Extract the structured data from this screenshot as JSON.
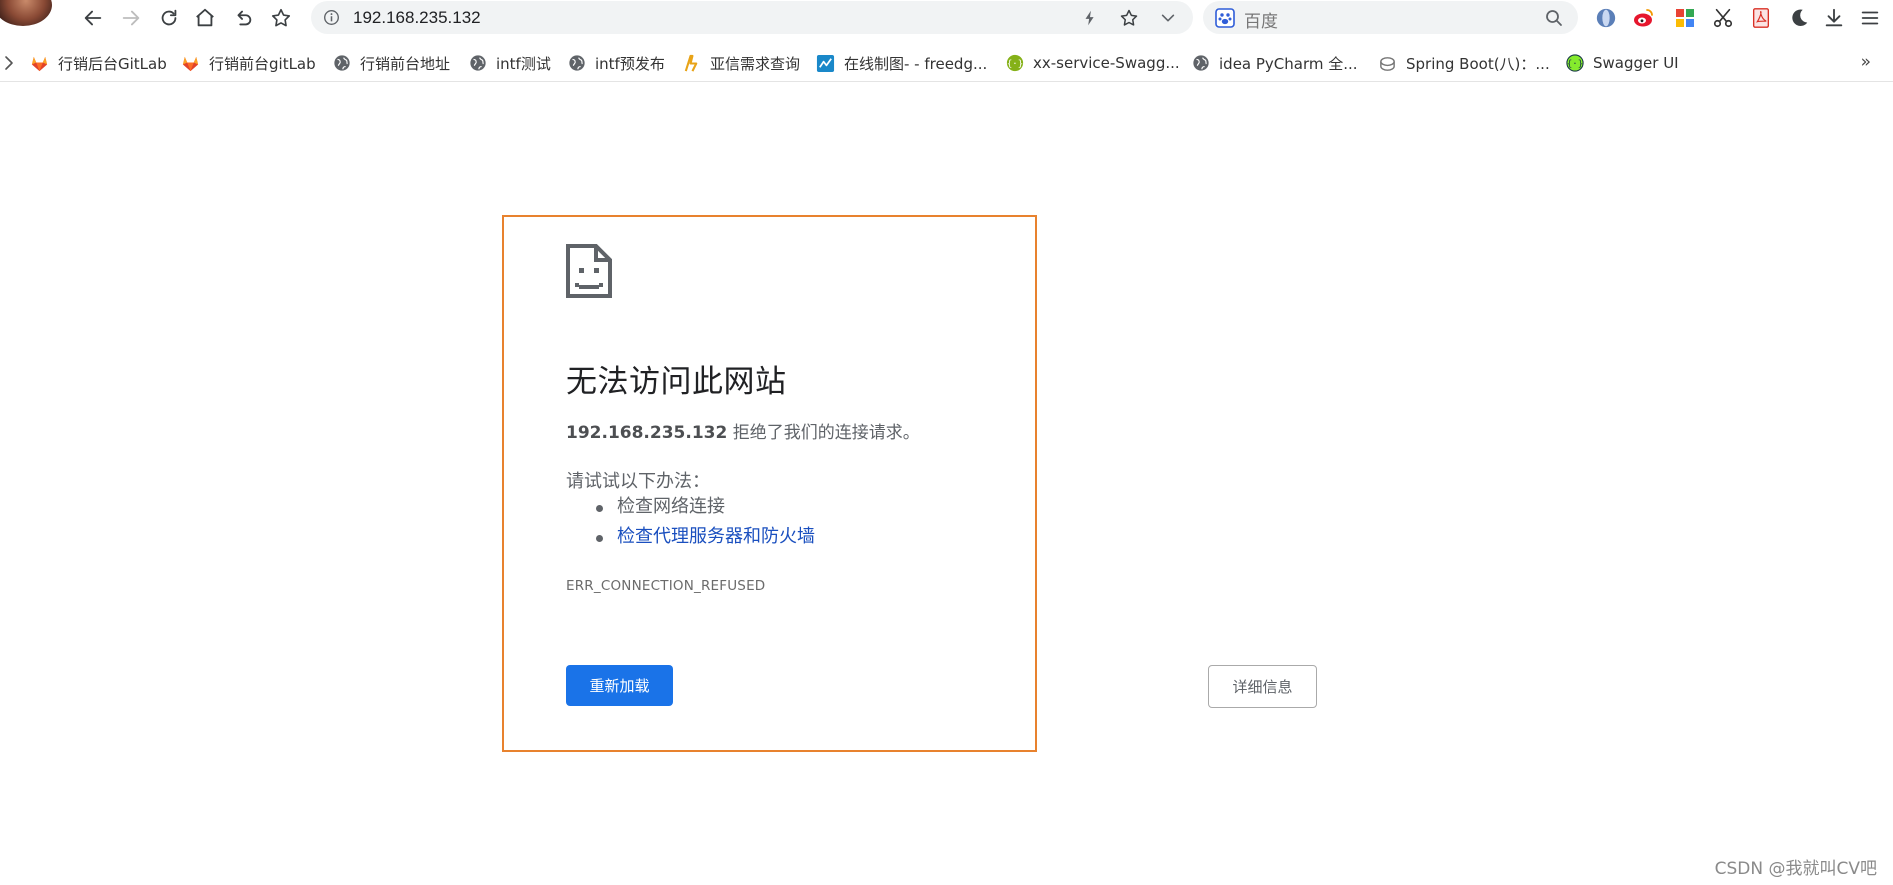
{
  "toolbar": {
    "url": "192.168.235.132",
    "search_placeholder": "百度"
  },
  "bookmarks": [
    {
      "label": "行销后台GitLab",
      "icon": "gitlab-icon"
    },
    {
      "label": "行销前台gitLab",
      "icon": "gitlab-icon"
    },
    {
      "label": "行销前台地址",
      "icon": "globe-icon"
    },
    {
      "label": "intf测试",
      "icon": "globe-icon"
    },
    {
      "label": "intf预发布",
      "icon": "globe-icon"
    },
    {
      "label": "亚信需求查询",
      "icon": "asiainfo-icon"
    },
    {
      "label": "在线制图- - freedg...",
      "icon": "chart-icon"
    },
    {
      "label": "xx-service-Swagg...",
      "icon": "swagger-icon"
    },
    {
      "label": "idea PyCharm 全...",
      "icon": "globe-icon"
    },
    {
      "label": "Spring Boot(八)：...",
      "icon": "spring-icon"
    },
    {
      "label": "Swagger UI",
      "icon": "swagger-icon"
    }
  ],
  "bookmarks_more": "»",
  "error": {
    "title": "无法访问此网站",
    "host": "192.168.235.132",
    "desc": " 拒绝了我们的连接请求。",
    "try_title": "请试试以下办法：",
    "suggestions": [
      "检查网络连接",
      "检查代理服务器和防火墙"
    ],
    "code": "ERR_CONNECTION_REFUSED",
    "reload_label": "重新加载",
    "details_label": "详细信息"
  },
  "watermark": "CSDN @我就叫CV吧",
  "colors": {
    "accent": "#1a73e8",
    "highlight_border": "#e8822e",
    "link": "#1a4fbf"
  }
}
